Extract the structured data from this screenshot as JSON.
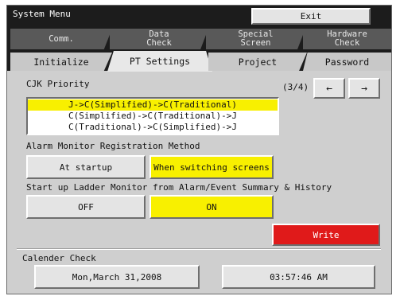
{
  "window": {
    "title": "System Menu",
    "exit_label": "Exit"
  },
  "tabs_row1": [
    {
      "label": "Comm."
    },
    {
      "label": "Data\nCheck"
    },
    {
      "label": "Special\nScreen"
    },
    {
      "label": "Hardware\nCheck"
    }
  ],
  "tabs_row2": [
    {
      "label": "Initialize"
    },
    {
      "label": "PT Settings",
      "active": true
    },
    {
      "label": "Project"
    },
    {
      "label": "Password"
    }
  ],
  "cjk": {
    "label": "CJK Priority",
    "page": "(3/4)",
    "prev": "←",
    "next": "→",
    "options": [
      "J->C(Simplified)->C(Traditional)",
      "C(Simplified)->C(Traditional)->J",
      "C(Traditional)->C(Simplified)->J"
    ],
    "selected_index": 0
  },
  "alarm": {
    "label": "Alarm Monitor Registration Method",
    "opt_startup": "At startup",
    "opt_switching": "When switching screens",
    "selected": "When switching screens"
  },
  "ladder": {
    "label": "Start up Ladder Monitor from Alarm/Event Summary & History",
    "off_label": "OFF",
    "on_label": "ON",
    "selected": "ON"
  },
  "write_label": "Write",
  "calendar": {
    "label": "Calender Check",
    "date": "Mon,March 31,2008",
    "time": "03:57:46 AM"
  },
  "colors": {
    "accent_yellow": "#f8f000",
    "write_red": "#e01a1a",
    "titlebar": "#1c1c1c"
  }
}
